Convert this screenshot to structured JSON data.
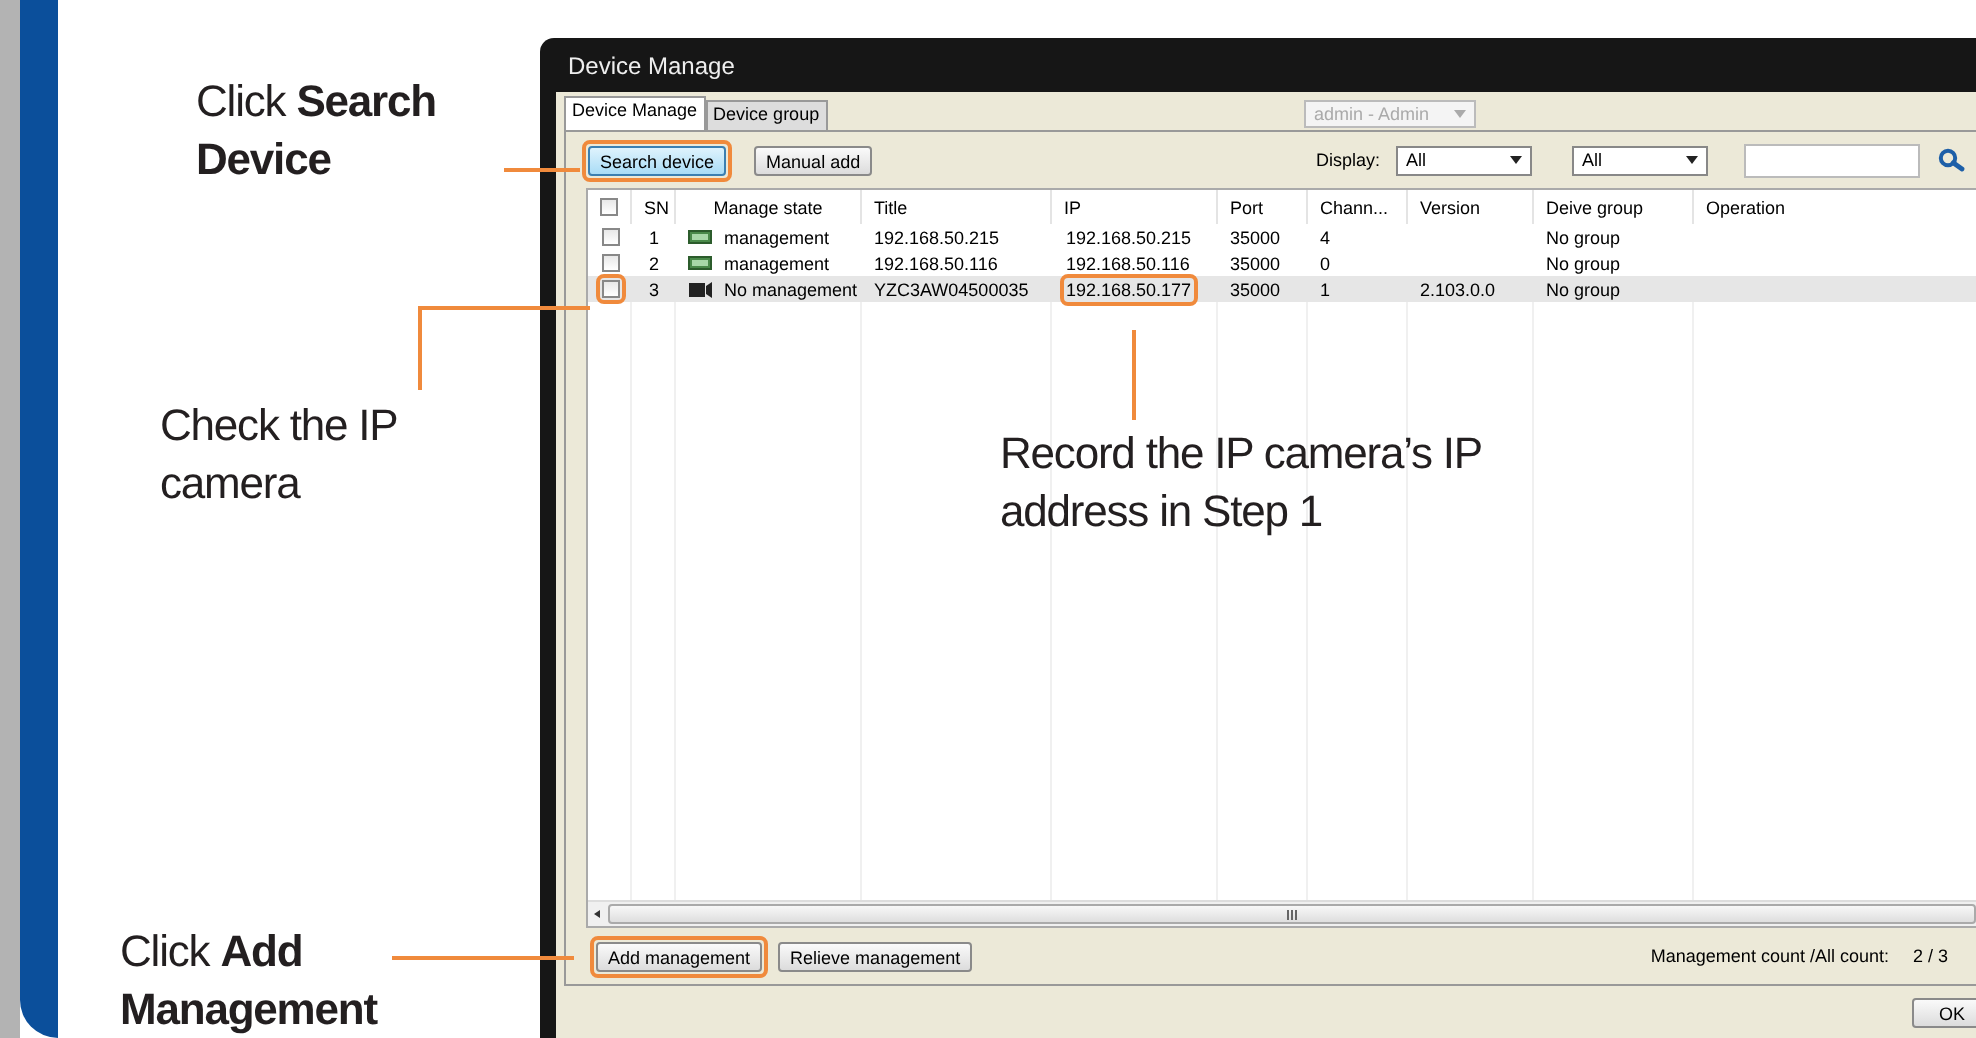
{
  "callouts": [
    {
      "text": "Click **Search Device**",
      "kind": "search"
    },
    {
      "text": "Check the IP camera",
      "kind": "check"
    },
    {
      "text": "Record the IP camera’s IP address in Step 1",
      "kind": "record"
    },
    {
      "text": "Click **Add Management**",
      "kind": "add"
    }
  ],
  "window": {
    "title": "Device Manage"
  },
  "tabs": [
    {
      "label": "Device Manage",
      "selected": true
    },
    {
      "label": "Device group",
      "selected": false
    }
  ],
  "user_select": {
    "value": "admin - Admin",
    "disabled": true
  },
  "toolbar": {
    "buttons": [
      {
        "label": "Search device",
        "highlighted": true,
        "focused": true
      },
      {
        "label": "Manual add",
        "highlighted": false,
        "focused": false
      }
    ],
    "display_label": "Display:",
    "display_select": "All",
    "filter_select": "All"
  },
  "table": {
    "header_checked": false,
    "columns": [
      "SN",
      "Manage state",
      "Title",
      "IP",
      "Port",
      "Chann...",
      "Version",
      "Deive group",
      "Operation"
    ],
    "rows": [
      {
        "checked": false,
        "selected": false,
        "managed": true,
        "highlight_checkbox": false,
        "highlight_ip": false,
        "cells": [
          "1",
          "management",
          "192.168.50.215",
          "192.168.50.215",
          "35000",
          "4",
          "",
          "No group",
          ""
        ]
      },
      {
        "checked": false,
        "selected": false,
        "managed": true,
        "highlight_checkbox": false,
        "highlight_ip": false,
        "cells": [
          "2",
          "management",
          "192.168.50.116",
          "192.168.50.116",
          "35000",
          "0",
          "",
          "No group",
          ""
        ]
      },
      {
        "checked": false,
        "selected": true,
        "managed": false,
        "highlight_checkbox": true,
        "highlight_ip": true,
        "cells": [
          "3",
          "No management",
          "YZC3AW04500035",
          "192.168.50.177",
          "35000",
          "1",
          "2.103.0.0",
          "No group",
          ""
        ]
      }
    ]
  },
  "bottom": {
    "buttons": [
      {
        "label": "Add management",
        "highlighted": true
      },
      {
        "label": "Relieve management",
        "highlighted": false
      }
    ],
    "count_label": "Management count /All count:",
    "count_value": "2 / 3"
  },
  "ok_button": "OK"
}
